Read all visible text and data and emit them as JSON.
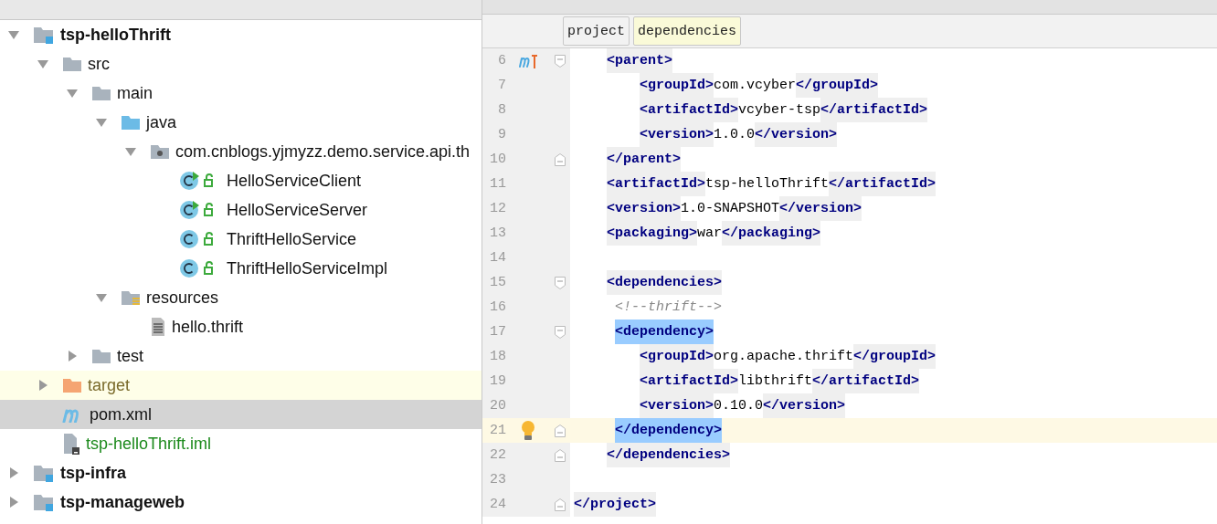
{
  "project_tree": [
    {
      "label": "tsp-helloThrift",
      "kind": "module",
      "expanded": true,
      "selected": false,
      "children": [
        {
          "label": "src",
          "kind": "folder",
          "expanded": true,
          "selected": false,
          "children": [
            {
              "label": "main",
              "kind": "folder",
              "expanded": true,
              "selected": false,
              "children": [
                {
                  "label": "java",
                  "kind": "source-folder",
                  "expanded": true,
                  "selected": false,
                  "children": [
                    {
                      "label": "com.cnblogs.yjmyzz.demo.service.api.th",
                      "kind": "package",
                      "expanded": true,
                      "selected": false,
                      "children": [
                        {
                          "label": "HelloServiceClient",
                          "kind": "runnable-class",
                          "selected": false
                        },
                        {
                          "label": "HelloServiceServer",
                          "kind": "runnable-class",
                          "selected": false
                        },
                        {
                          "label": "ThriftHelloService",
                          "kind": "class",
                          "selected": false
                        },
                        {
                          "label": "ThriftHelloServiceImpl",
                          "kind": "class",
                          "selected": false
                        }
                      ]
                    }
                  ]
                },
                {
                  "label": "resources",
                  "kind": "resources-folder",
                  "expanded": true,
                  "selected": false,
                  "children": [
                    {
                      "label": "hello.thrift",
                      "kind": "text-file",
                      "selected": false
                    }
                  ]
                }
              ]
            },
            {
              "label": "test",
              "kind": "folder",
              "expanded": false,
              "selected": false
            }
          ]
        },
        {
          "label": "target",
          "kind": "excluded-folder",
          "expanded": false,
          "selected": false
        },
        {
          "label": "pom.xml",
          "kind": "maven-file",
          "selected": true
        },
        {
          "label": "tsp-helloThrift.iml",
          "kind": "iml-file",
          "selected": false
        }
      ]
    },
    {
      "label": "tsp-infra",
      "kind": "module",
      "expanded": false,
      "selected": false
    },
    {
      "label": "tsp-manageweb",
      "kind": "module",
      "expanded": false,
      "selected": false
    }
  ],
  "editor": {
    "breadcrumbs": [
      {
        "label": "project",
        "selected": false
      },
      {
        "label": "dependencies",
        "selected": true
      }
    ],
    "lines": [
      {
        "number": "6",
        "kind": "element",
        "gutter_icon": {
          "kind": "maven"
        },
        "fold_marker": {
          "kind": "start"
        },
        "current": false,
        "tokens": [
          {
            "kind": "tag",
            "text": "<parent>"
          }
        ],
        "children": [
          {
            "number": "7",
            "kind": "element",
            "current": false,
            "tokens": [
              {
                "kind": "tag",
                "text": "<groupId>"
              },
              {
                "kind": "value",
                "text": "com.vcyber"
              },
              {
                "kind": "tag",
                "text": "</groupId>"
              }
            ]
          },
          {
            "number": "8",
            "kind": "element",
            "current": false,
            "tokens": [
              {
                "kind": "tag",
                "text": "<artifactId>"
              },
              {
                "kind": "value",
                "text": "vcyber-tsp"
              },
              {
                "kind": "tag",
                "text": "</artifactId>"
              }
            ]
          },
          {
            "number": "9",
            "kind": "element",
            "current": false,
            "tokens": [
              {
                "kind": "tag",
                "text": "<version>"
              },
              {
                "kind": "value",
                "text": "1.0.0"
              },
              {
                "kind": "tag",
                "text": "</version>"
              }
            ]
          }
        ]
      },
      {
        "number": "10",
        "kind": "element",
        "fold_marker": {
          "kind": "end"
        },
        "current": false,
        "tokens": [
          {
            "kind": "tag",
            "text": "</parent>"
          }
        ]
      },
      {
        "number": "11",
        "kind": "element",
        "current": false,
        "tokens": [
          {
            "kind": "tag",
            "text": "<artifactId>"
          },
          {
            "kind": "value",
            "text": "tsp-helloThrift"
          },
          {
            "kind": "tag",
            "text": "</artifactId>"
          }
        ]
      },
      {
        "number": "12",
        "kind": "element",
        "current": false,
        "tokens": [
          {
            "kind": "tag",
            "text": "<version>"
          },
          {
            "kind": "value",
            "text": "1.0-SNAPSHOT"
          },
          {
            "kind": "tag",
            "text": "</version>"
          }
        ]
      },
      {
        "number": "13",
        "kind": "element",
        "current": false,
        "tokens": [
          {
            "kind": "tag",
            "text": "<packaging>"
          },
          {
            "kind": "value",
            "text": "war"
          },
          {
            "kind": "tag",
            "text": "</packaging>"
          }
        ]
      },
      {
        "number": "14",
        "kind": "element",
        "current": false
      },
      {
        "number": "15",
        "kind": "element",
        "fold_marker": {
          "kind": "start"
        },
        "current": false,
        "tokens": [
          {
            "kind": "tag",
            "text": "<dependencies>"
          }
        ],
        "children": [
          {
            "number": "16",
            "kind": "shifted",
            "current": false,
            "tokens": [
              {
                "kind": "comment",
                "text": "<!--thrift-->"
              }
            ]
          },
          {
            "number": "17",
            "kind": "shifted",
            "fold_marker": {
              "kind": "start"
            },
            "current": false,
            "tokens": [
              {
                "kind": "tag",
                "text": "<dependency>",
                "matched": true
              }
            ]
          },
          {
            "number": "18",
            "kind": "element",
            "current": false,
            "tokens": [
              {
                "kind": "tag",
                "text": "<groupId>"
              },
              {
                "kind": "value",
                "text": "org.apache.thrift"
              },
              {
                "kind": "tag",
                "text": "</groupId>"
              }
            ]
          },
          {
            "number": "19",
            "kind": "element",
            "current": false,
            "tokens": [
              {
                "kind": "tag",
                "text": "<artifactId>"
              },
              {
                "kind": "value",
                "text": "libthrift"
              },
              {
                "kind": "tag",
                "text": "</artifactId>"
              }
            ]
          },
          {
            "number": "20",
            "kind": "element",
            "current": false,
            "tokens": [
              {
                "kind": "tag",
                "text": "<version>"
              },
              {
                "kind": "value",
                "text": "0.10.0"
              },
              {
                "kind": "tag",
                "text": "</version>"
              }
            ]
          },
          {
            "number": "21",
            "kind": "shifted",
            "gutter_icon": {
              "kind": "bulb"
            },
            "fold_marker": {
              "kind": "end"
            },
            "current": true,
            "tokens": [
              {
                "kind": "tag",
                "text": "</dependency>",
                "matched": true
              }
            ]
          }
        ]
      },
      {
        "number": "22",
        "kind": "element",
        "fold_marker": {
          "kind": "end"
        },
        "current": false,
        "tokens": [
          {
            "kind": "tag",
            "text": "</dependencies>"
          }
        ]
      },
      {
        "number": "23",
        "kind": "element",
        "current": false
      },
      {
        "number": "24",
        "kind": "root-close",
        "fold_marker": {
          "kind": "end"
        },
        "current": false,
        "tokens": [
          {
            "kind": "tag",
            "text": "</project>"
          }
        ]
      }
    ]
  }
}
